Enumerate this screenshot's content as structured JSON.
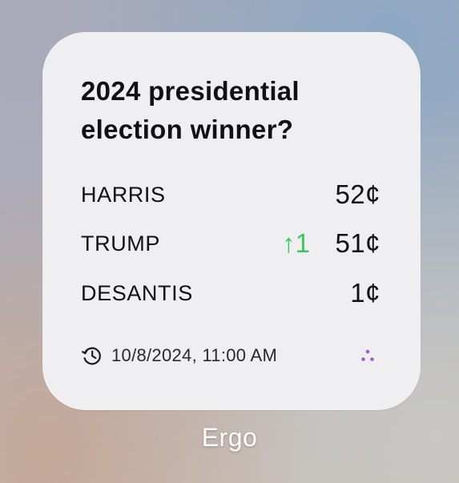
{
  "widget": {
    "title": "2024 presidential election winner?",
    "candidates": [
      {
        "name": "HARRIS",
        "change": "",
        "price": "52¢"
      },
      {
        "name": "TRUMP",
        "change": "↑1",
        "price": "51¢"
      },
      {
        "name": "DESANTIS",
        "change": "",
        "price": "1¢"
      }
    ],
    "updated": "10/8/2024, 11:00 AM",
    "updated_icon": "clock-history-icon",
    "logo_icon": "ergo-dots-icon"
  },
  "app": {
    "label": "Ergo"
  },
  "colors": {
    "card_background": "#efeff1",
    "text": "#111111",
    "up_change": "#3ec461",
    "logo": "#a757d6"
  }
}
